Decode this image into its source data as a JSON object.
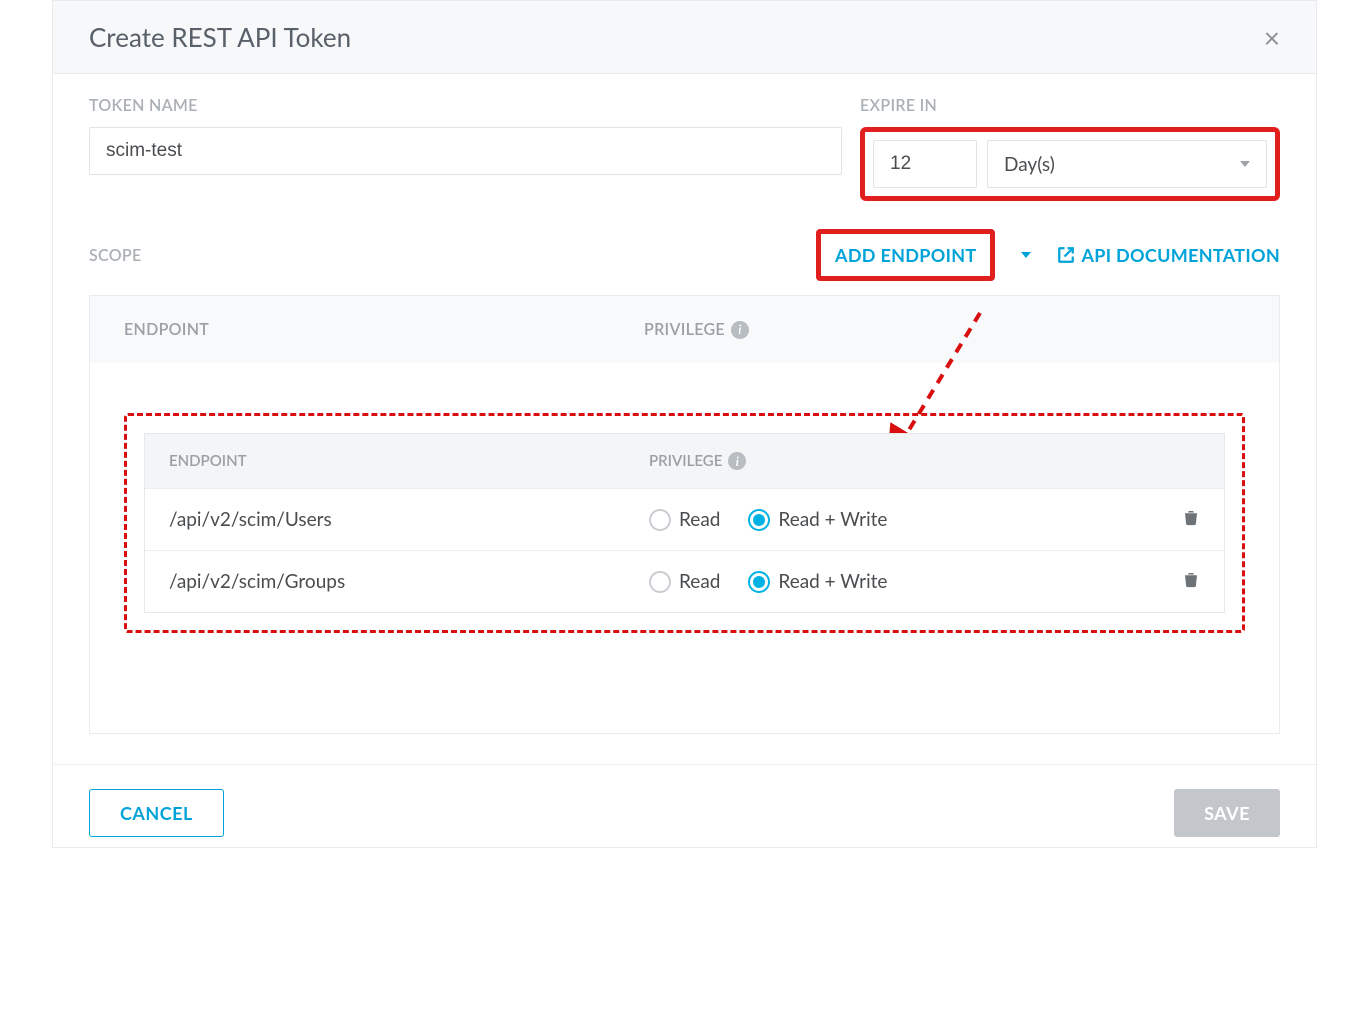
{
  "dialog": {
    "title": "Create REST API Token",
    "close_icon": "×"
  },
  "form": {
    "token_name_label": "TOKEN NAME",
    "token_name_value": "scim-test",
    "expire_label": "EXPIRE IN",
    "expire_value": "12",
    "expire_unit": "Day(s)"
  },
  "scope": {
    "label": "SCOPE",
    "add_endpoint": "ADD ENDPOINT",
    "api_docs": "API DOCUMENTATION",
    "header_endpoint": "ENDPOINT",
    "header_privilege": "PRIVILEGE",
    "inner_header_endpoint": "ENDPOINT",
    "inner_header_privilege": "PRIVILEGE",
    "radio_read": "Read",
    "radio_readwrite": "Read + Write",
    "rows": [
      {
        "path": "/api/v2/scim/Users",
        "read": false,
        "readwrite": true
      },
      {
        "path": "/api/v2/scim/Groups",
        "read": false,
        "readwrite": true
      }
    ]
  },
  "footer": {
    "cancel": "CANCEL",
    "save": "SAVE"
  },
  "annotation": {
    "highlight_color": "#e11f1f"
  }
}
